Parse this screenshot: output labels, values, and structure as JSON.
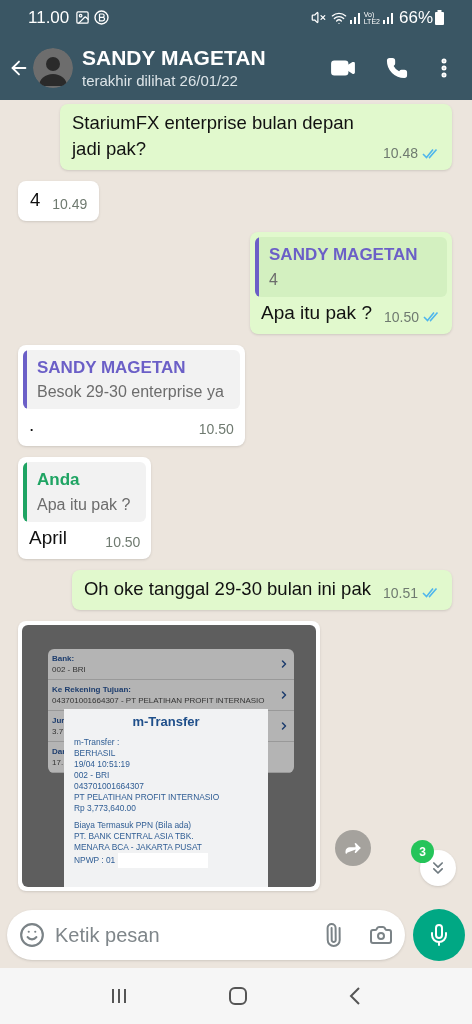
{
  "status_bar": {
    "time": "11.00",
    "volte": [
      "Vo)",
      "LTE2"
    ],
    "battery": "66%"
  },
  "header": {
    "name": "SANDY MAGETAN",
    "last_seen": "terakhir dilihat 26/01/22"
  },
  "messages": [
    {
      "kind": "text",
      "outgoing": true,
      "text": "StariumFX enterprise bulan depan jadi pak?",
      "time": "10.48",
      "read": true
    },
    {
      "kind": "text",
      "outgoing": false,
      "text": "4",
      "time": "10.49"
    },
    {
      "kind": "reply",
      "outgoing": true,
      "quote": {
        "author": "SANDY MAGETAN",
        "text": "4",
        "color": "#6b5fc7"
      },
      "text": "Apa itu pak ?",
      "time": "10.50",
      "read": true
    },
    {
      "kind": "reply",
      "outgoing": false,
      "quote": {
        "author": "SANDY MAGETAN",
        "text": "Besok 29-30 enterprise ya",
        "color": "#6b5fc7"
      },
      "text": ".",
      "time": "10.50"
    },
    {
      "kind": "reply",
      "outgoing": false,
      "quote": {
        "author": "Anda",
        "text": "Apa itu pak ?",
        "color": "#1fa463"
      },
      "text": "April",
      "time": "10.50"
    },
    {
      "kind": "text",
      "outgoing": true,
      "text": "Oh oke tanggal 29-30 bulan ini pak",
      "time": "10.51",
      "read": true
    },
    {
      "kind": "image",
      "outgoing": false,
      "screenshot": {
        "rows": [
          {
            "label": "Bank:",
            "value": "002 - BRI",
            "arrow": true
          },
          {
            "label": "Ke Rekening Tujuan:",
            "value": "043701001664307 - PT PELATIHAN PROFIT INTERNASIO",
            "arrow": true
          },
          {
            "label": "Jur",
            "value": "3.7",
            "arrow": true
          },
          {
            "label": "Dar",
            "value": "17.",
            "arrow": false
          }
        ],
        "dialog": {
          "title": "m-Transfer",
          "paragraphs": [
            [
              "m-Transfer :",
              "BERHASIL",
              "19/04 10:51:19",
              "002 - BRI",
              "043701001664307",
              "PT PELATIHAN PROFIT INTERNASIO",
              "Rp 3,773,640.00"
            ],
            [
              "Biaya Termasuk PPN (Bila ada)",
              "PT. BANK CENTRAL ASIA TBK.",
              "MENARA BCA - JAKARTA PUSAT",
              "NPWP : 01"
            ]
          ],
          "redacted": true
        }
      }
    }
  ],
  "unread_count": "3",
  "composer": {
    "placeholder": "Ketik pesan"
  }
}
